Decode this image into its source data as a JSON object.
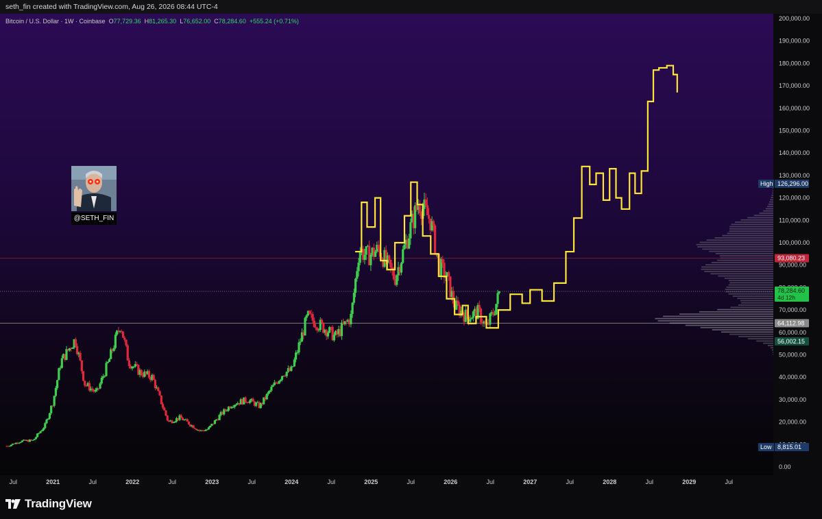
{
  "header": {
    "caption": "seth_fin created with TradingView.com, Aug 26, 2026 08:44 UTC-4"
  },
  "legend": {
    "symbol": "Bitcoin / U.S. Dollar · 1W · Coinbase",
    "open_label": "O",
    "open": "77,729.36",
    "high_label": "H",
    "high": "81,265.30",
    "low_label": "L",
    "low": "76,652.00",
    "close_label": "C",
    "close": "78,284.60",
    "change": "+555.24 (+0.71%)"
  },
  "avatar": {
    "handle": "@SETH_FIN"
  },
  "footer": {
    "brand": "TradingView"
  },
  "colors": {
    "up": "#3fcf4f",
    "down": "#e0283c",
    "projection": "#ffe53a",
    "high_label_bg": "#1e3a66",
    "red_label_bg": "#c0283a",
    "green_label_bg": "#22c24a",
    "gray_label_bg": "#8a8a8a",
    "teal_label_bg": "#14503c"
  },
  "chart_data": {
    "type": "line",
    "title": "",
    "symbol": "Bitcoin / U.S. Dollar · 1W · Coinbase",
    "y_axis": {
      "ylim": [
        0,
        200000
      ],
      "ticks": [
        "200,000.00",
        "190,000.00",
        "180,000.00",
        "170,000.00",
        "160,000.00",
        "150,000.00",
        "140,000.00",
        "130,000.00",
        "120,000.00",
        "110,000.00",
        "100,000.00",
        "90,000.00",
        "80,000.00",
        "70,000.00",
        "60,000.00",
        "50,000.00",
        "40,000.00",
        "30,000.00",
        "20,000.00",
        "10,000.00",
        "0.00"
      ],
      "tick_values": [
        200000,
        190000,
        180000,
        170000,
        160000,
        150000,
        140000,
        130000,
        120000,
        110000,
        100000,
        90000,
        80000,
        70000,
        60000,
        50000,
        40000,
        30000,
        20000,
        10000,
        0
      ]
    },
    "x_axis": {
      "xlim": [
        2020.42,
        2029.8
      ],
      "ticks": [
        "Jul",
        "2021",
        "Jul",
        "2022",
        "Jul",
        "2023",
        "Jul",
        "2024",
        "Jul",
        "2025",
        "Jul",
        "2026",
        "Jul",
        "2027",
        "Jul",
        "2028",
        "Jul",
        "2029",
        "Jul"
      ],
      "tick_values": [
        2020.5,
        2021,
        2021.5,
        2022,
        2022.5,
        2023,
        2023.5,
        2024,
        2024.5,
        2025,
        2025.5,
        2026,
        2026.5,
        2027,
        2027.5,
        2028,
        2028.5,
        2029,
        2029.5
      ]
    },
    "price_labels": [
      {
        "name": "High",
        "prefix": "High",
        "text": "126,296.00",
        "value": 126296,
        "color": "high"
      },
      {
        "name": "level-93080",
        "text": "93,080.23",
        "value": 93080,
        "color": "red"
      },
      {
        "name": "last-price",
        "text": "78,284.60",
        "sub": "4d 12h",
        "value": 78284,
        "color": "green"
      },
      {
        "name": "level-64112",
        "text": "64,112.98",
        "value": 64113,
        "color": "gray"
      },
      {
        "name": "level-56002",
        "text": "56,002.15",
        "value": 56002,
        "color": "teal"
      },
      {
        "name": "Low",
        "prefix": "Low",
        "text": "8,815.01",
        "value": 8815,
        "color": "high"
      }
    ],
    "horizontal_lines": [
      93080,
      78284,
      64113
    ],
    "series": [
      {
        "kind": "weekly-candles",
        "key_closes": {
          "x": [
            2020.42,
            2020.6,
            2020.75,
            2020.9,
            2021.0,
            2021.1,
            2021.28,
            2021.4,
            2021.55,
            2021.7,
            2021.85,
            2021.95,
            2022.1,
            2022.25,
            2022.45,
            2022.6,
            2022.85,
            2022.95,
            2023.1,
            2023.25,
            2023.45,
            2023.6,
            2023.75,
            2023.9,
            2024.0,
            2024.2,
            2024.45,
            2024.55,
            2024.75,
            2024.85,
            2024.95,
            2025.1,
            2025.3,
            2025.5,
            2025.6,
            2025.75,
            2025.85,
            2025.95,
            2026.05,
            2026.2,
            2026.35,
            2026.45,
            2026.55,
            2026.62
          ],
          "y": [
            9300,
            11500,
            11800,
            18500,
            29000,
            47000,
            57000,
            37000,
            33000,
            47000,
            64000,
            47000,
            42000,
            40000,
            20000,
            22000,
            16000,
            16800,
            23000,
            28000,
            30000,
            27000,
            35000,
            42000,
            43000,
            67000,
            61000,
            58000,
            67000,
            97000,
            94000,
            97000,
            84000,
            107000,
            118000,
            110000,
            90000,
            85000,
            72000,
            67000,
            69000,
            62000,
            70000,
            78284
          ]
        }
      },
      {
        "kind": "projection",
        "x": [
          2024.8,
          2024.88,
          2024.95,
          2025.05,
          2025.12,
          2025.2,
          2025.3,
          2025.42,
          2025.5,
          2025.58,
          2025.65,
          2025.75,
          2025.85,
          2025.95,
          2026.05,
          2026.15,
          2026.22,
          2026.32,
          2026.45,
          2026.6,
          2026.75,
          2026.9,
          2027.0,
          2027.15,
          2027.3,
          2027.45,
          2027.55,
          2027.65,
          2027.75,
          2027.83,
          2027.92,
          2028.0,
          2028.08,
          2028.15,
          2028.25,
          2028.32,
          2028.4,
          2028.48,
          2028.55,
          2028.62,
          2028.72,
          2028.8,
          2028.85
        ],
        "y": [
          96000,
          118000,
          107000,
          120000,
          92000,
          88000,
          100000,
          112000,
          127000,
          117000,
          103000,
          95000,
          85000,
          75000,
          68000,
          72000,
          64000,
          67000,
          62000,
          70000,
          77000,
          73000,
          79000,
          74000,
          82000,
          96000,
          111000,
          134000,
          126000,
          131000,
          119000,
          133000,
          120000,
          115000,
          131000,
          122000,
          132000,
          163000,
          177000,
          178000,
          179000,
          175000,
          167000
        ]
      }
    ]
  }
}
